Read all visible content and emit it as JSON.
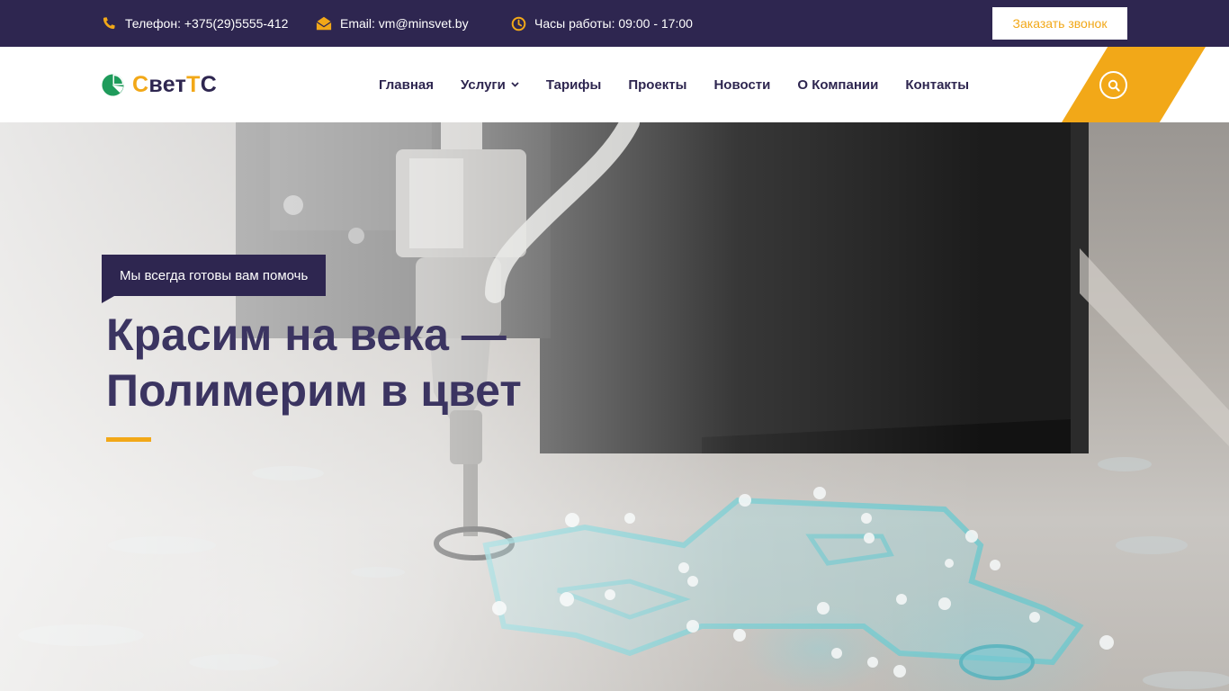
{
  "topbar": {
    "phone_label": "Телефон: +375(29)5555-412",
    "email_label": "Email: vm@minsvet.by",
    "hours_label": "Часы работы: 09:00 - 17:00",
    "callback_button": "Заказать звонок",
    "icons": {
      "phone": "phone-icon",
      "email": "envelope-icon",
      "hours": "clock-icon"
    },
    "icon_color": "#f2a818",
    "background": "#2e2650"
  },
  "header": {
    "logo": {
      "part1": "С",
      "part2": "вет",
      "part3": "Т",
      "part4": "С"
    },
    "nav": [
      {
        "label": "Главная"
      },
      {
        "label": "Услуги",
        "has_dropdown": true
      },
      {
        "label": "Тарифы"
      },
      {
        "label": "Проекты"
      },
      {
        "label": "Новости"
      },
      {
        "label": "О Компании"
      },
      {
        "label": "Контакты"
      }
    ],
    "search_icon": "search-icon",
    "accent_color": "#f2a818"
  },
  "hero": {
    "tagline": "Мы всегда готовы вам помочь",
    "headline_line1": "Красим на века —",
    "headline_line2": "Полимерим в цвет",
    "headline_color": "#3b3461"
  }
}
